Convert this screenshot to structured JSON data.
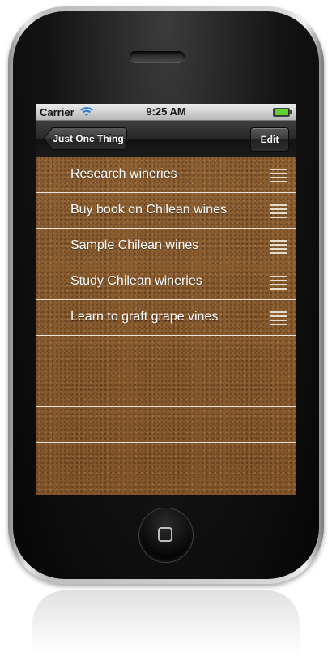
{
  "status_bar": {
    "carrier": "Carrier",
    "time": "9:25 AM",
    "wifi_icon": "wifi-icon",
    "battery_icon": "battery-icon"
  },
  "nav_bar": {
    "back_label": "Just One Thing",
    "edit_label": "Edit"
  },
  "list": {
    "items": [
      {
        "label": "Research wineries"
      },
      {
        "label": "Buy book on Chilean wines"
      },
      {
        "label": "Sample Chilean wines"
      },
      {
        "label": "Study Chilean wineries"
      },
      {
        "label": "Learn to graft grape vines"
      }
    ],
    "reorder_icon": "reorder-grip-icon"
  },
  "colors": {
    "cork": "#8a5d31",
    "separator": "#e9e3d9",
    "battery_green": "#5fd12e"
  }
}
